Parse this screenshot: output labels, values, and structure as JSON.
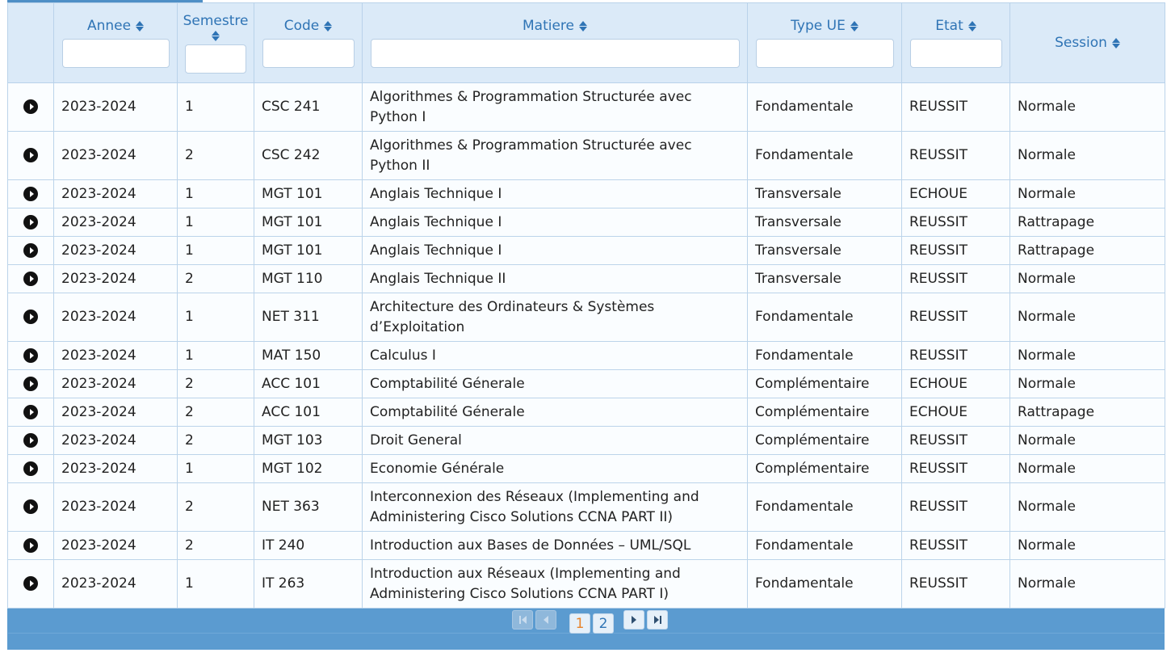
{
  "columns": {
    "annee": "Annee",
    "semestre": "Semestre",
    "code": "Code",
    "matiere": "Matiere",
    "type_ue": "Type UE",
    "etat": "Etat",
    "session": "Session"
  },
  "rows": [
    {
      "annee": "2023-2024",
      "semestre": "1",
      "code": "CSC 241",
      "matiere": "Algorithmes & Programmation Structurée avec Python I",
      "type_ue": "Fondamentale",
      "etat": "REUSSIT",
      "session": "Normale"
    },
    {
      "annee": "2023-2024",
      "semestre": "2",
      "code": "CSC 242",
      "matiere": "Algorithmes & Programmation Structurée avec Python II",
      "type_ue": "Fondamentale",
      "etat": "REUSSIT",
      "session": "Normale"
    },
    {
      "annee": "2023-2024",
      "semestre": "1",
      "code": "MGT 101",
      "matiere": "Anglais Technique I",
      "type_ue": "Transversale",
      "etat": "ECHOUE",
      "session": "Normale"
    },
    {
      "annee": "2023-2024",
      "semestre": "1",
      "code": "MGT 101",
      "matiere": "Anglais Technique I",
      "type_ue": "Transversale",
      "etat": "REUSSIT",
      "session": "Rattrapage"
    },
    {
      "annee": "2023-2024",
      "semestre": "1",
      "code": "MGT 101",
      "matiere": "Anglais Technique I",
      "type_ue": "Transversale",
      "etat": "REUSSIT",
      "session": "Rattrapage"
    },
    {
      "annee": "2023-2024",
      "semestre": "2",
      "code": "MGT 110",
      "matiere": "Anglais Technique II",
      "type_ue": "Transversale",
      "etat": "REUSSIT",
      "session": "Normale"
    },
    {
      "annee": "2023-2024",
      "semestre": "1",
      "code": "NET 311",
      "matiere": "Architecture des Ordinateurs & Systèmes d’Exploitation",
      "type_ue": "Fondamentale",
      "etat": "REUSSIT",
      "session": "Normale"
    },
    {
      "annee": "2023-2024",
      "semestre": "1",
      "code": "MAT 150",
      "matiere": "Calculus I",
      "type_ue": "Fondamentale",
      "etat": "REUSSIT",
      "session": "Normale"
    },
    {
      "annee": "2023-2024",
      "semestre": "2",
      "code": "ACC 101",
      "matiere": "Comptabilité Génerale",
      "type_ue": "Complémentaire",
      "etat": "ECHOUE",
      "session": "Normale"
    },
    {
      "annee": "2023-2024",
      "semestre": "2",
      "code": "ACC 101",
      "matiere": "Comptabilité Génerale",
      "type_ue": "Complémentaire",
      "etat": "ECHOUE",
      "session": "Rattrapage"
    },
    {
      "annee": "2023-2024",
      "semestre": "2",
      "code": "MGT 103",
      "matiere": "Droit General",
      "type_ue": "Complémentaire",
      "etat": "REUSSIT",
      "session": "Normale"
    },
    {
      "annee": "2023-2024",
      "semestre": "1",
      "code": "MGT 102",
      "matiere": "Economie Générale",
      "type_ue": "Complémentaire",
      "etat": "REUSSIT",
      "session": "Normale"
    },
    {
      "annee": "2023-2024",
      "semestre": "2",
      "code": "NET 363",
      "matiere": "Interconnexion des Réseaux (Implementing and Administering Cisco Solutions CCNA PART II)",
      "type_ue": "Fondamentale",
      "etat": "REUSSIT",
      "session": "Normale"
    },
    {
      "annee": "2023-2024",
      "semestre": "2",
      "code": "IT 240",
      "matiere": "Introduction aux Bases de Données – UML/SQL",
      "type_ue": "Fondamentale",
      "etat": "REUSSIT",
      "session": "Normale"
    },
    {
      "annee": "2023-2024",
      "semestre": "1",
      "code": "IT 263",
      "matiere": "Introduction aux Réseaux (Implementing and Administering Cisco Solutions CCNA PART I)",
      "type_ue": "Fondamentale",
      "etat": "REUSSIT",
      "session": "Normale"
    }
  ],
  "paginator": {
    "pages": [
      "1",
      "2"
    ],
    "current_page": "1"
  },
  "colors": {
    "header_bg": "#dbeaf8",
    "header_text": "#2f74b5",
    "paginator_bg": "#5b9bd0",
    "active_page": "#e8832a"
  }
}
